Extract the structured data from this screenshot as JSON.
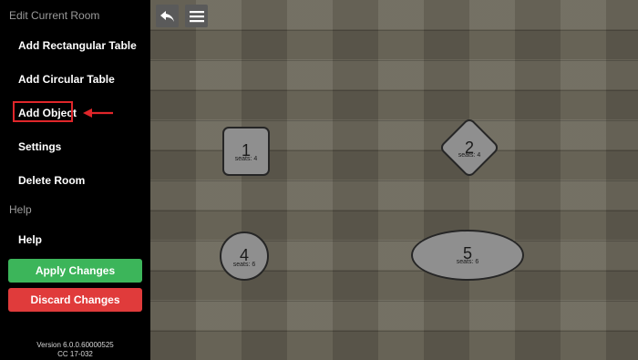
{
  "sidebar": {
    "edit_section": "Edit Current Room",
    "items": [
      {
        "label": "Add Rectangular Table"
      },
      {
        "label": "Add Circular Table"
      },
      {
        "label": "Add Object"
      },
      {
        "label": "Settings"
      },
      {
        "label": "Delete Room"
      }
    ],
    "help_section": "Help",
    "help_item": "Help",
    "apply_label": "Apply Changes",
    "discard_label": "Discard Changes",
    "version": "Version 6.0.0.60000525",
    "code": "CC 17-032"
  },
  "toolbar": {
    "back_icon": "back-arrow-icon",
    "menu_icon": "hamburger-menu-icon"
  },
  "tables": [
    {
      "number": "1",
      "seats": "seats: 4",
      "shape": "rounded-square"
    },
    {
      "number": "2",
      "seats": "seats: 4",
      "shape": "diamond"
    },
    {
      "number": "4",
      "seats": "seats: 6",
      "shape": "circle"
    },
    {
      "number": "5",
      "seats": "seats: 6",
      "shape": "ellipse"
    }
  ],
  "colors": {
    "apply": "#3cb55a",
    "discard": "#e03b3b",
    "highlight": "#e0262a"
  }
}
